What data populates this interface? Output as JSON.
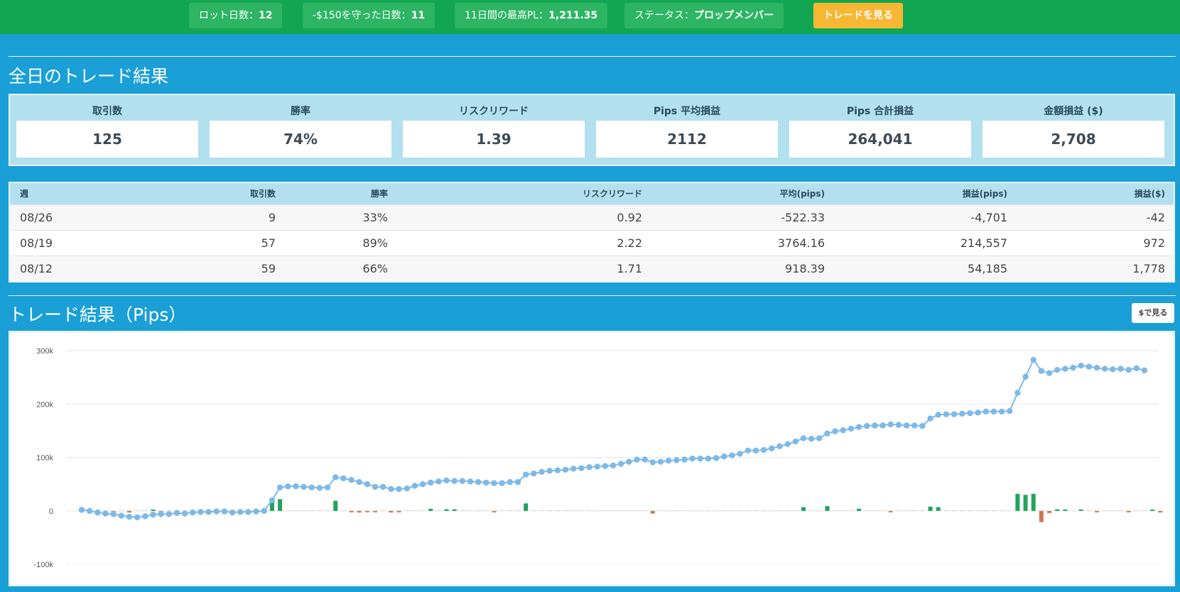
{
  "topbar": {
    "lot_days_label": "ロット日数：",
    "lot_days_value": "12",
    "kept150_label": "-$150を守った日数：",
    "kept150_value": "11",
    "best_pl_label": "11日間の最高PL：",
    "best_pl_value": "1,211.35",
    "status_label": "ステータス：",
    "status_value": "プロップメンバー",
    "view_trades_button": "トレードを見る"
  },
  "summary": {
    "title": "全日のトレード結果",
    "stats": [
      {
        "label": "取引数",
        "value": "125"
      },
      {
        "label": "勝率",
        "value": "74%"
      },
      {
        "label": "リスクリワード",
        "value": "1.39"
      },
      {
        "label": "Pips 平均損益",
        "value": "2112"
      },
      {
        "label": "Pips 合計損益",
        "value": "264,041"
      },
      {
        "label": "金額損益 ($)",
        "value": "2,708"
      }
    ]
  },
  "weekly": {
    "headers": [
      "週",
      "取引数",
      "勝率",
      "リスクリワード",
      "平均(pips)",
      "損益(pips)",
      "損益($)"
    ],
    "rows": [
      [
        "08/26",
        "9",
        "33%",
        "0.92",
        "-522.33",
        "-4,701",
        "-42"
      ],
      [
        "08/19",
        "57",
        "89%",
        "2.22",
        "3764.16",
        "214,557",
        "972"
      ],
      [
        "08/12",
        "59",
        "66%",
        "1.71",
        "918.39",
        "54,185",
        "1,778"
      ]
    ]
  },
  "chart_section": {
    "title": "トレード結果（Pips）",
    "toggle_button": "$で見る"
  },
  "colors": {
    "topbar": "#12a652",
    "page": "#1a9fd6",
    "accent_button": "#f7b733",
    "line": "#7db9e8",
    "gain_bar": "#21a35a",
    "loss_bar": "#c97a54"
  },
  "chart_data": {
    "type": "line",
    "title": "",
    "xlabel": "",
    "ylabel": "",
    "ylim": [
      -100000,
      300000
    ],
    "yticks": [
      "300k",
      "200k",
      "100k",
      "0",
      "-100k"
    ],
    "ytick_values": [
      300000,
      200000,
      100000,
      0,
      -100000
    ],
    "grid": true,
    "series": [
      {
        "type": "line",
        "values": [
          2000,
          0,
          -3000,
          -5000,
          -6000,
          -9000,
          -11000,
          -12000,
          -10000,
          -7000,
          -6000,
          -6000,
          -4000,
          -5000,
          -3000,
          -2000,
          -2000,
          -1000,
          -1000,
          -3000,
          -2000,
          -2000,
          -1000,
          0,
          20000,
          44000,
          46000,
          46000,
          45000,
          44000,
          43000,
          44000,
          63000,
          61000,
          58000,
          54000,
          50000,
          45000,
          45000,
          41000,
          41000,
          42000,
          47000,
          50000,
          53000,
          55000,
          57000,
          56000,
          56000,
          55000,
          54000,
          53000,
          52000,
          52000,
          54000,
          54000,
          68000,
          70000,
          73000,
          75000,
          76000,
          77000,
          79000,
          80000,
          82000,
          83000,
          84000,
          85000,
          88000,
          92000,
          96000,
          96000,
          91000,
          92000,
          94000,
          95000,
          96000,
          98000,
          98000,
          98000,
          99000,
          102000,
          104000,
          107000,
          113000,
          113000,
          114000,
          117000,
          121000,
          125000,
          130000,
          136000,
          135000,
          136000,
          145000,
          149000,
          151000,
          154000,
          157000,
          159000,
          160000,
          160000,
          162000,
          161000,
          160000,
          160000,
          159000,
          173000,
          180000,
          181000,
          181000,
          182000,
          183000,
          184000,
          186000,
          186000,
          186000,
          187000,
          221000,
          251000,
          283000,
          262000,
          258000,
          264000,
          266000,
          268000,
          272000,
          270000,
          268000,
          266000,
          265000,
          266000,
          264000,
          267000,
          263000
        ]
      },
      {
        "type": "bar",
        "values": [
          0,
          0,
          0,
          0,
          -1000,
          0,
          -3000,
          0,
          0,
          2000,
          -1000,
          0,
          0,
          0,
          0,
          0,
          0,
          0,
          0,
          0,
          0,
          0,
          0,
          0,
          20000,
          22000,
          0,
          0,
          0,
          0,
          0,
          0,
          19000,
          0,
          -2000,
          -3000,
          -2000,
          -2000,
          0,
          -3000,
          -2000,
          0,
          0,
          0,
          4000,
          0,
          3000,
          3000,
          0,
          0,
          0,
          0,
          -1000,
          0,
          0,
          0,
          14000,
          0,
          0,
          0,
          0,
          0,
          0,
          0,
          0,
          0,
          0,
          0,
          0,
          0,
          0,
          0,
          -5000,
          0,
          0,
          0,
          0,
          0,
          0,
          0,
          0,
          0,
          0,
          0,
          0,
          0,
          0,
          0,
          0,
          0,
          0,
          7000,
          0,
          0,
          9000,
          0,
          0,
          0,
          4000,
          0,
          0,
          0,
          -1000,
          0,
          0,
          0,
          0,
          8000,
          7000,
          0,
          0,
          0,
          0,
          0,
          0,
          0,
          0,
          0,
          32000,
          30000,
          32000,
          -21000,
          -4000,
          3000,
          2000,
          0,
          2000,
          0,
          -1000,
          0,
          0,
          0,
          -1000,
          0,
          0,
          2000,
          -3000
        ]
      }
    ]
  }
}
